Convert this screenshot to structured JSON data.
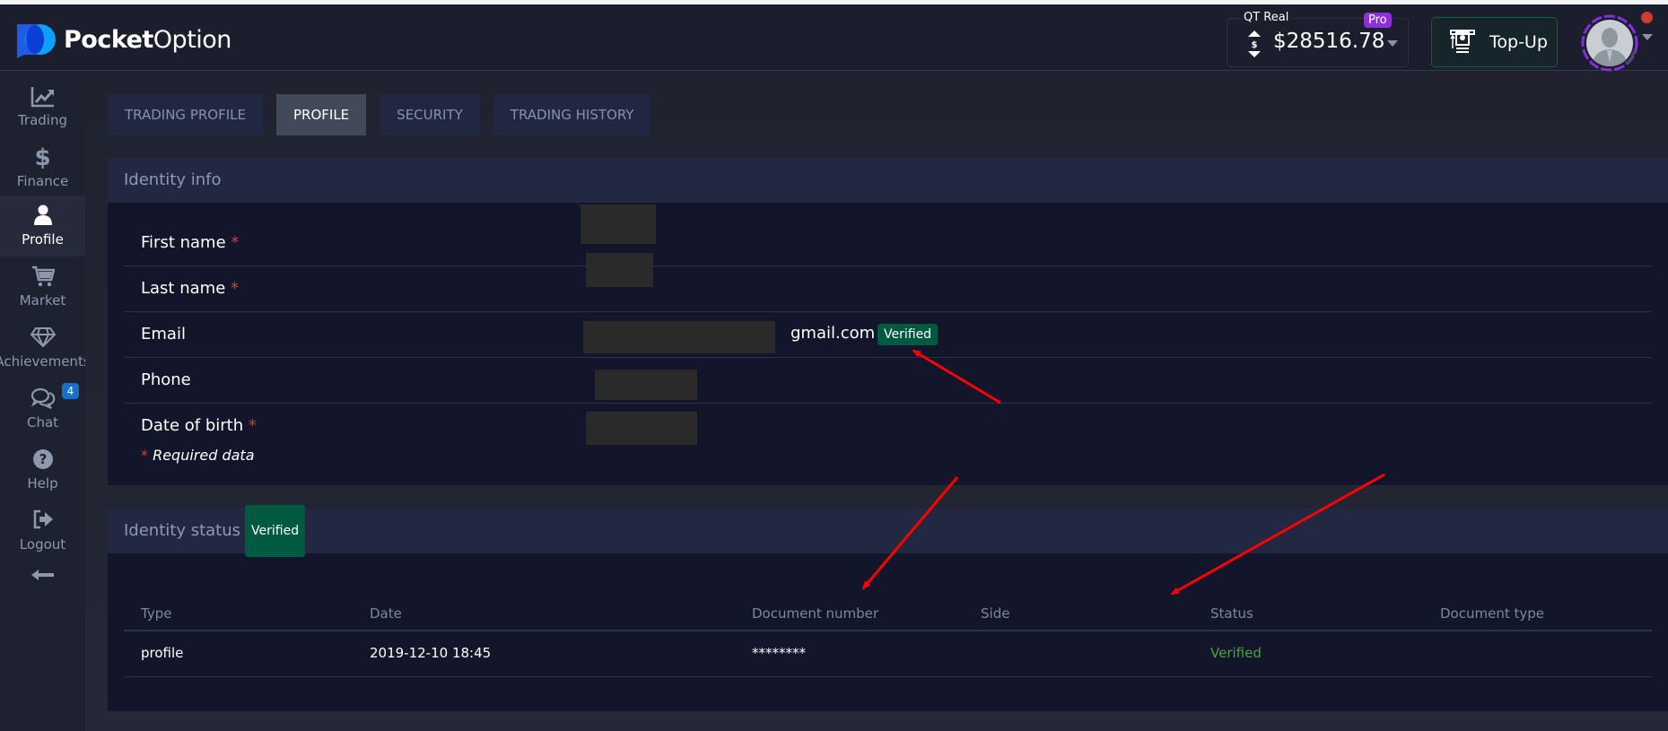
{
  "app": {
    "brand_bold": "Pocket",
    "brand_light": "Option"
  },
  "header": {
    "account_label": "QT Real",
    "pro_badge": "Pro",
    "balance": "$28516.78",
    "topup_label": "Top-Up"
  },
  "sidebar": {
    "items": [
      {
        "label": "Trading",
        "icon": "chart-line-icon"
      },
      {
        "label": "Finance",
        "icon": "dollar-icon"
      },
      {
        "label": "Profile",
        "icon": "user-icon",
        "active": true
      },
      {
        "label": "Market",
        "icon": "cart-icon"
      },
      {
        "label": "Achievements",
        "icon": "diamond-icon"
      },
      {
        "label": "Chat",
        "icon": "chat-icon",
        "badge": "4"
      },
      {
        "label": "Help",
        "icon": "help-icon"
      },
      {
        "label": "Logout",
        "icon": "logout-icon"
      }
    ],
    "collapse_icon": "arrow-left-icon"
  },
  "tabs": [
    {
      "label": "TRADING PROFILE"
    },
    {
      "label": "PROFILE",
      "active": true
    },
    {
      "label": "SECURITY"
    },
    {
      "label": "TRADING HISTORY"
    }
  ],
  "identity_info": {
    "title": "Identity info",
    "fields": [
      {
        "label": "First name",
        "required": "*"
      },
      {
        "label": "Last name",
        "required": "*"
      },
      {
        "label": "Email",
        "value_suffix": "gmail.com",
        "badge": "Verified"
      },
      {
        "label": "Phone"
      },
      {
        "label": "Date of birth",
        "required": "*"
      }
    ],
    "required_note_star": "*",
    "required_note": "Required data"
  },
  "identity_status": {
    "title": "Identity status",
    "badge": "Verified",
    "columns": [
      "Type",
      "Date",
      "Document number",
      "Side",
      "Status",
      "Document type"
    ],
    "rows": [
      {
        "type": "profile",
        "date": "2019-12-10 18:45",
        "document_number": "********",
        "side": "",
        "status": "Verified",
        "document_type": ""
      }
    ]
  },
  "colors": {
    "verified_badge": "#005a3f",
    "status_verified": "#43a63e",
    "required_star": "#c8443a",
    "pro_badge": "#8e2fd9",
    "annotation_arrow": "#ff0000"
  }
}
